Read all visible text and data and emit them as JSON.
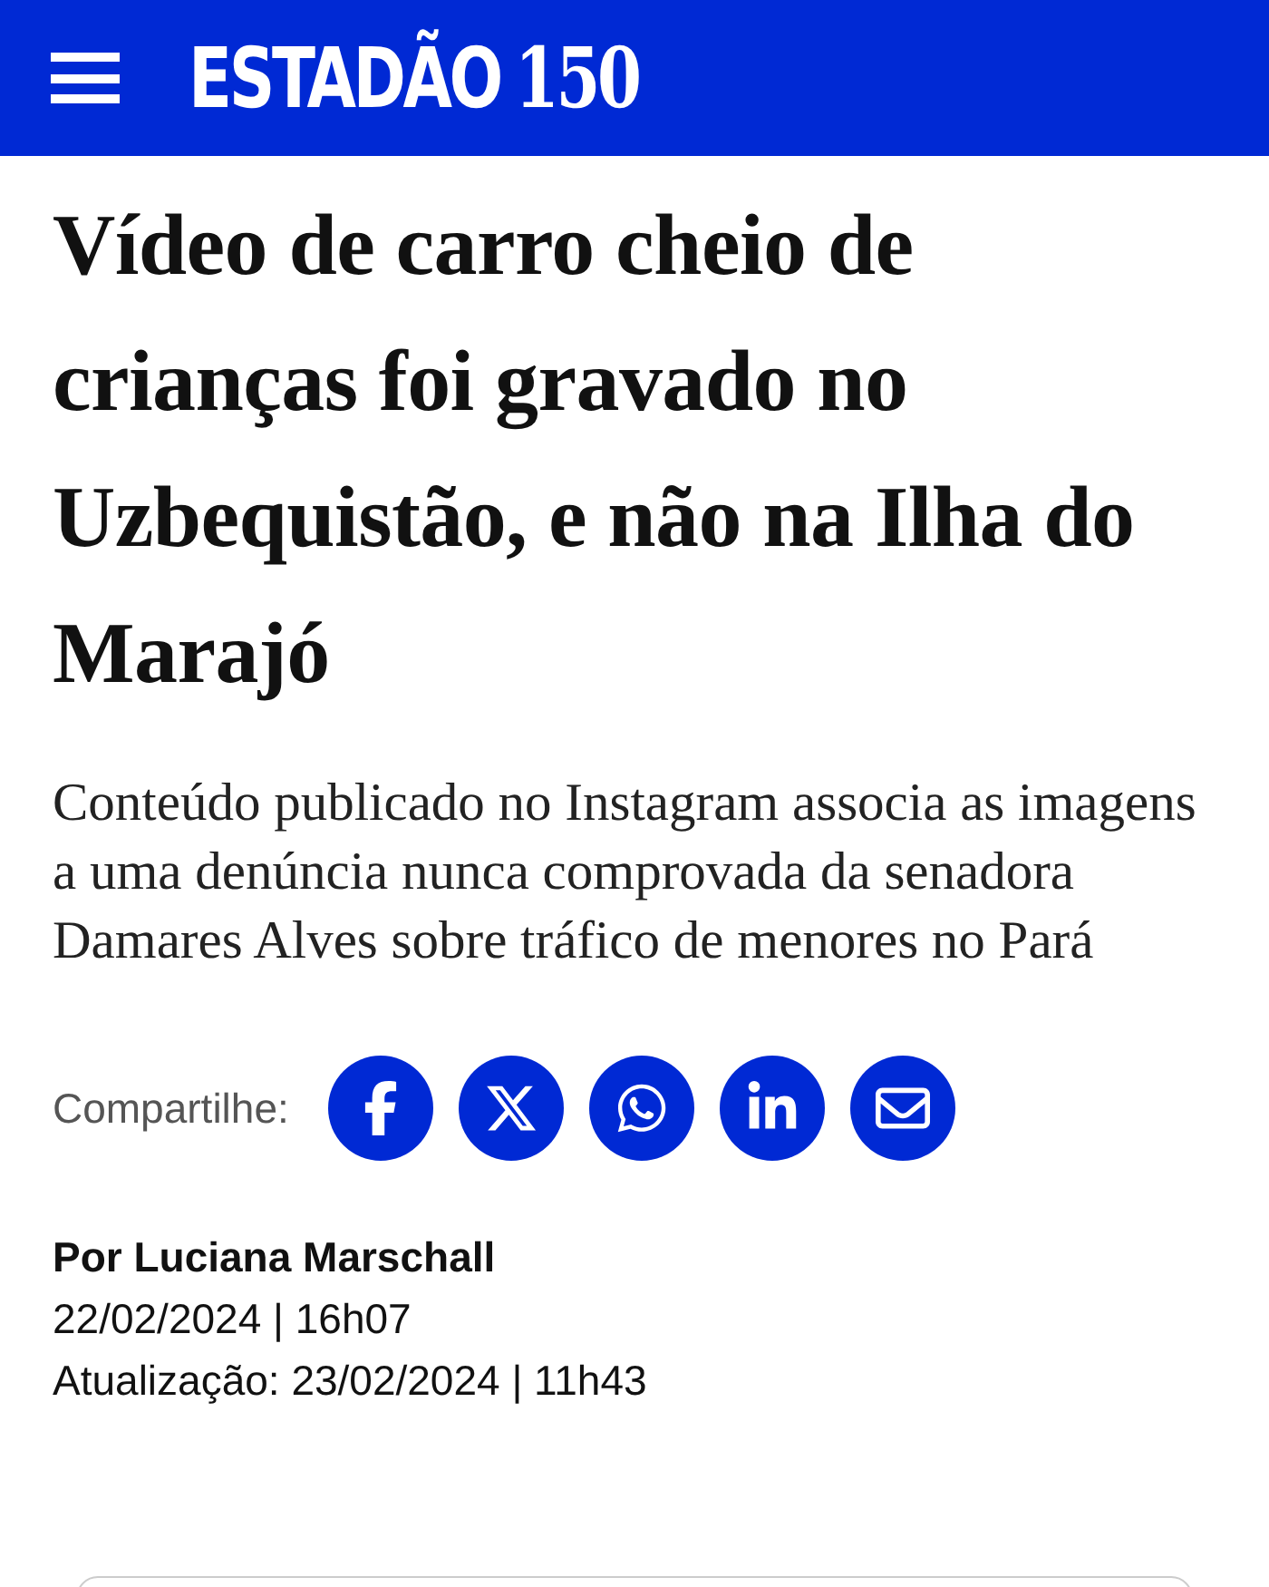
{
  "header": {
    "logo_name": "ESTADÃO",
    "logo_number": "150"
  },
  "headline": "Vídeo de carro cheio de crianças foi gravado no Uzbequistão, e não na Ilha do Marajó",
  "subheadline": "Conteúdo publicado no Instagram associa as imagens a uma denúncia nunca comprovada da senadora Damares Alves sobre tráfico de menores no Pará",
  "share": {
    "label": "Compartilhe:",
    "buttons": [
      {
        "kind": "facebook"
      },
      {
        "kind": "x"
      },
      {
        "kind": "whatsapp"
      },
      {
        "kind": "linkedin"
      },
      {
        "kind": "email"
      }
    ]
  },
  "byline": {
    "author": "Por Luciana Marschall",
    "published": "22/02/2024 | 16h07",
    "updated": "Atualização: 23/02/2024 | 11h43"
  }
}
